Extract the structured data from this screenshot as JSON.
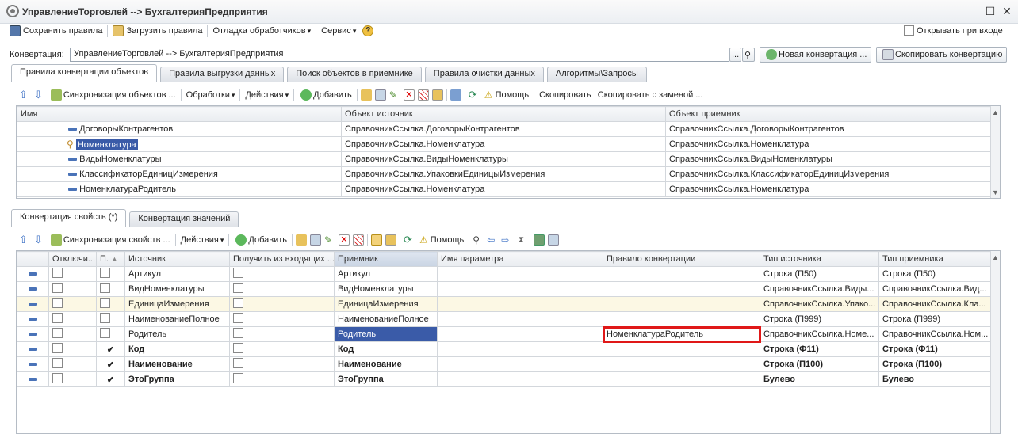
{
  "window": {
    "title": "УправлениеТорговлей --> БухгалтерияПредприятия",
    "minimize": "_",
    "maximize": "☐",
    "close": "✕"
  },
  "toolbar1": {
    "save": "Сохранить правила",
    "load": "Загрузить правила",
    "debug": "Отладка обработчиков",
    "service": "Сервис",
    "open_on_login": "Открывать при входе"
  },
  "conversion": {
    "label": "Конвертация:",
    "value": "УправлениеТорговлей --> БухгалтерияПредприятия",
    "dots": "...",
    "new_btn": "Новая конвертация ...",
    "copy_btn": "Скопировать конвертацию"
  },
  "tabs_top": [
    "Правила конвертации объектов",
    "Правила выгрузки данных",
    "Поиск объектов в приемнике",
    "Правила очистки данных",
    "Алгоритмы\\Запросы"
  ],
  "toolbar2": {
    "sync": "Синхронизация объектов ...",
    "processing": "Обработки",
    "actions": "Действия",
    "add": "Добавить",
    "help": "Помощь",
    "copy": "Скопировать",
    "copy_replace": "Скопировать с заменой ..."
  },
  "table1": {
    "headers": [
      "Имя",
      "Объект источник",
      "Объект приемник"
    ],
    "rows": [
      [
        "ДоговорыКонтрагентов",
        "СправочникСсылка.ДоговорыКонтрагентов",
        "СправочникСсылка.ДоговорыКонтрагентов"
      ],
      [
        "Номенклатура",
        "СправочникСсылка.Номенклатура",
        "СправочникСсылка.Номенклатура"
      ],
      [
        "ВидыНоменклатуры",
        "СправочникСсылка.ВидыНоменклатуры",
        "СправочникСсылка.ВидыНоменклатуры"
      ],
      [
        "КлассификаторЕдиницИзмерения",
        "СправочникСсылка.УпаковкиЕдиницыИзмерения",
        "СправочникСсылка.КлассификаторЕдиницИзмерения"
      ],
      [
        "НоменклатураРодитель",
        "СправочникСсылка.Номенклатура",
        "СправочникСсылка.Номенклатура"
      ]
    ]
  },
  "tabs_bottom": [
    "Конвертация свойств (*)",
    "Конвертация значений"
  ],
  "toolbar3": {
    "sync": "Синхронизация свойств ...",
    "actions": "Действия",
    "add": "Добавить",
    "help": "Помощь"
  },
  "table2": {
    "headers": [
      "Отключи...",
      "П.",
      "Источник",
      "Получить из входящих ...",
      "Приемник",
      "Имя параметра",
      "Правило конвертации",
      "Тип источника",
      "Тип приемника"
    ],
    "rows": [
      {
        "checked": "",
        "src": "Артикул",
        "dst": "Артикул",
        "rule": "",
        "tsrc": "Строка (П50)",
        "tdst": "Строка (П50)"
      },
      {
        "checked": "",
        "src": "ВидНоменклатуры",
        "dst": "ВидНоменклатуры",
        "rule": "",
        "tsrc": "СправочникСсылка.Виды...",
        "tdst": "СправочникСсылка.Вид..."
      },
      {
        "checked": "",
        "src": "ЕдиницаИзмерения",
        "dst": "ЕдиницаИзмерения",
        "rule": "",
        "tsrc": "СправочникСсылка.Упако...",
        "tdst": "СправочникСсылка.Кла..."
      },
      {
        "checked": "",
        "src": "НаименованиеПолное",
        "dst": "НаименованиеПолное",
        "rule": "",
        "tsrc": "Строка (П999)",
        "tdst": "Строка (П999)"
      },
      {
        "checked": "",
        "src": "Родитель",
        "dst": "Родитель",
        "rule": "НоменклатураРодитель",
        "tsrc": "СправочникСсылка.Номе...",
        "tdst": "СправочникСсылка.Ном..."
      },
      {
        "checked": "✔",
        "src": "Код",
        "dst": "Код",
        "rule": "",
        "tsrc": "Строка (Ф11)",
        "tdst": "Строка (Ф11)"
      },
      {
        "checked": "✔",
        "src": "Наименование",
        "dst": "Наименование",
        "rule": "",
        "tsrc": "Строка (П100)",
        "tdst": "Строка (П100)"
      },
      {
        "checked": "✔",
        "src": "ЭтоГруппа",
        "dst": "ЭтоГруппа",
        "rule": "",
        "tsrc": "Булево",
        "tdst": "Булево"
      }
    ]
  }
}
